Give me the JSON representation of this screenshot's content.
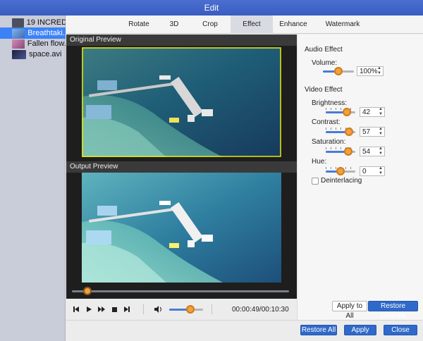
{
  "window": {
    "title": "Edit"
  },
  "sidebar": {
    "items": [
      {
        "label": "19 INCRED...",
        "active": false,
        "thumb_color": "#4c4f5c"
      },
      {
        "label": "Breathtaki...",
        "active": true,
        "thumb_color": "#5f88c6"
      },
      {
        "label": "Fallen flow...",
        "active": false,
        "thumb_color": "#b86a95"
      },
      {
        "label": "space.avi",
        "active": false,
        "thumb_color": "#2f3655"
      }
    ]
  },
  "tabs": [
    {
      "label": "Rotate",
      "active": false
    },
    {
      "label": "3D",
      "active": false
    },
    {
      "label": "Crop",
      "active": false
    },
    {
      "label": "Effect",
      "active": true
    },
    {
      "label": "Enhance",
      "active": false
    },
    {
      "label": "Watermark",
      "active": false
    }
  ],
  "preview": {
    "original_label": "Original Preview",
    "output_label": "Output Preview",
    "timeline_position": 0.07,
    "volume_level": 0.62,
    "time_display": "00:00:49/00:10:30"
  },
  "audio_effect": {
    "title": "Audio Effect",
    "volume_label": "Volume:",
    "volume_value": "100%",
    "volume_fraction": 0.5
  },
  "video_effect": {
    "title": "Video Effect",
    "brightness_label": "Brightness:",
    "brightness_value": "42",
    "brightness_fraction": 0.71,
    "contrast_label": "Contrast:",
    "contrast_value": "57",
    "contrast_fraction": 0.79,
    "saturation_label": "Saturation:",
    "saturation_value": "54",
    "saturation_fraction": 0.77,
    "hue_label": "Hue:",
    "hue_value": "0",
    "hue_fraction": 0.5,
    "deinterlacing_label": "Deinterlacing"
  },
  "buttons": {
    "apply_to_all": "Apply to All",
    "restore_defaults": "Restore Defaults",
    "restore_all": "Restore All",
    "apply": "Apply",
    "close": "Close"
  },
  "icons": {
    "skip_back": "skip-back-icon",
    "play": "play-icon",
    "fast_forward": "fast-forward-icon",
    "stop": "stop-icon",
    "skip_forward": "skip-forward-icon",
    "volume": "volume-icon"
  },
  "colors": {
    "accent": "#2f69c9",
    "selected_item": "#3b82f6",
    "knob": "#f0a040",
    "crop_frame": "#e6e600"
  }
}
